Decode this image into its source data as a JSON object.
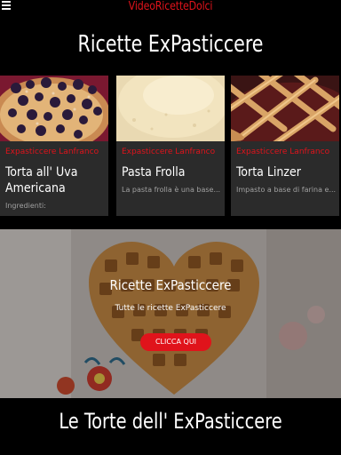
{
  "header": {
    "brand": "VideoRicetteDolci"
  },
  "section": {
    "title": "Ricette ExPasticcere"
  },
  "cards": [
    {
      "category": "Expasticcere Lanfranco",
      "title": "Torta all' Uva Americana",
      "excerpt": "Ingredienti:"
    },
    {
      "category": "Expasticcere Lanfranco",
      "title": "Pasta Frolla",
      "excerpt": "La pasta frolla è una base..."
    },
    {
      "category": "Expasticcere Lanfranco",
      "title": "Torta Linzer",
      "excerpt": "Impasto a base di farina e..."
    }
  ],
  "hero": {
    "title": "Ricette ExPasticcere",
    "subtitle": "Tutte le ricette ExPasticcere",
    "cta_label": "CLICCA QUI"
  },
  "footer": {
    "title": "Le Torte dell' ExPasticcere"
  },
  "colors": {
    "accent": "#e0131b",
    "card_bg": "#2b2b2b",
    "background": "#000000"
  },
  "icons": {
    "menu": "hamburger-menu-icon"
  }
}
